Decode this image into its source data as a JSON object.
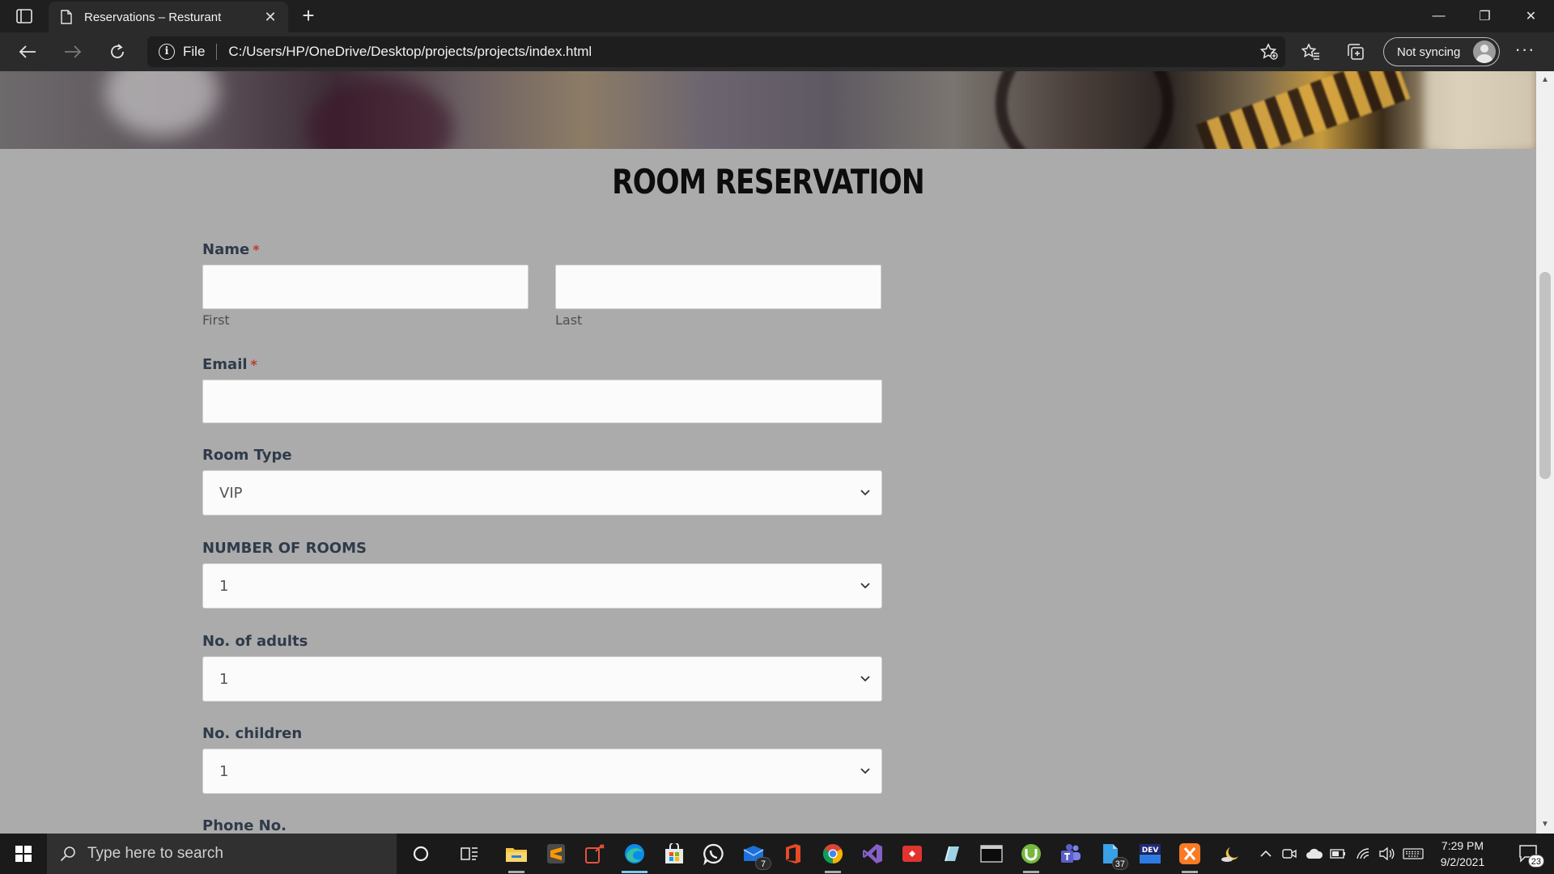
{
  "browser": {
    "tab_title": "Reservations – Resturant",
    "new_tab_symbol": "+",
    "address_scheme_label": "File",
    "url": "C:/Users/HP/OneDrive/Desktop/projects/projects/index.html",
    "profile_label": "Not syncing",
    "window_controls": {
      "minimize": "—",
      "restore": "❐",
      "close": "✕"
    },
    "more_symbol": "···"
  },
  "page": {
    "title": "ROOM RESERVATION",
    "form": {
      "name_label": "Name",
      "required_mark": "*",
      "first_sublabel": "First",
      "last_sublabel": "Last",
      "first_value": "",
      "last_value": "",
      "email_label": "Email",
      "email_value": "",
      "room_type_label": "Room Type",
      "room_type_value": "VIP",
      "number_of_rooms_label": "NUMBER OF ROOMS",
      "number_of_rooms_value": "1",
      "adults_label": "No. of adults",
      "adults_value": "1",
      "children_label": "No. children",
      "children_value": "1",
      "phone_label": "Phone No."
    }
  },
  "taskbar": {
    "search_placeholder": "Type here to search",
    "time": "7:29 PM",
    "date": "9/2/2021",
    "notification_count": "23",
    "mail_badge": "7",
    "file_badge": "37",
    "accent_colors": {
      "edge": "#0c8ce9",
      "teams": "#5b5fc7",
      "vs": "#865fc5",
      "xampp": "#fb7a24",
      "utorrent": "#76b83f",
      "sublime": "#ff9800"
    }
  }
}
